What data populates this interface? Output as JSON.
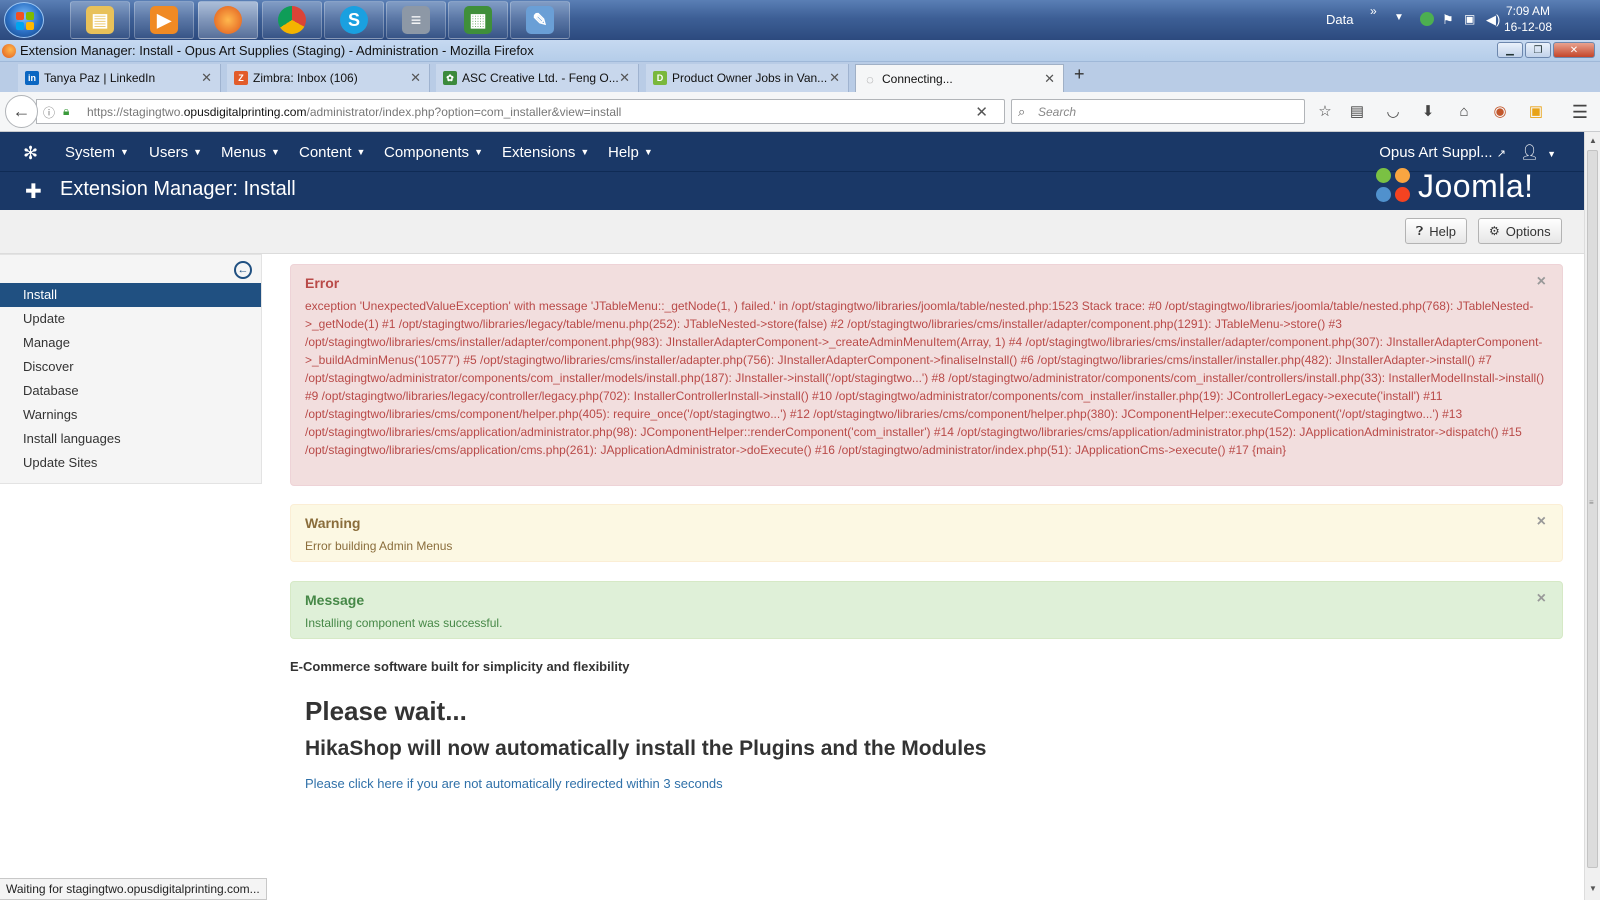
{
  "taskbar": {
    "apps": [
      {
        "name": "file-explorer",
        "color": "#e8c15a"
      },
      {
        "name": "media-player",
        "color": "#f08a24"
      },
      {
        "name": "firefox",
        "color": "#e8591c"
      },
      {
        "name": "chrome",
        "color": "#3e8e3e"
      },
      {
        "name": "skype",
        "color": "#1aa0e0",
        "glyph": "S"
      },
      {
        "name": "notepad",
        "color": "#8d98a6"
      },
      {
        "name": "excel",
        "color": "#3f8f3a"
      },
      {
        "name": "paint",
        "color": "#6a9fd6"
      }
    ],
    "tray": {
      "lang": "Data",
      "arrows": "»",
      "time": "7:09 AM",
      "date": "16-12-08"
    }
  },
  "window": {
    "title": "Extension Manager: Install - Opus Art Supplies (Staging) - Administration - Mozilla Firefox",
    "min": "▁",
    "max": "❐",
    "close": "✕"
  },
  "tabs": [
    {
      "label": "Tanya Paz | LinkedIn",
      "favicon": "in",
      "color": "#0a66c2"
    },
    {
      "label": "Zimbra: Inbox (106)",
      "favicon": "Z",
      "color": "#e25c2a"
    },
    {
      "label": "ASC Creative Ltd. - Feng O...",
      "favicon": "✿",
      "color": "#3b8a3b"
    },
    {
      "label": "Product Owner Jobs in Van...",
      "favicon": "D",
      "color": "#7ab83b"
    },
    {
      "label": "Connecting...",
      "favicon": "◌",
      "color": "#888888"
    }
  ],
  "newtab": "+",
  "nav": {
    "url_prefix": "https://stagingtwo.",
    "url_domain": "opusdigitalprinting.com",
    "url_path": "/administrator/index.php?option=com_installer&view=install",
    "search_placeholder": "Search"
  },
  "joomla": {
    "menu": [
      "System",
      "Users",
      "Menus",
      "Content",
      "Components",
      "Extensions",
      "Help"
    ],
    "site": "Opus Art Suppl...",
    "page_title": "Extension Manager: Install",
    "brand": "Joomla!",
    "toolbar": {
      "help": "Help",
      "options": "Options"
    },
    "sidebar": [
      "Install",
      "Update",
      "Manage",
      "Discover",
      "Database",
      "Warnings",
      "Install languages",
      "Update Sites"
    ],
    "alerts": {
      "error": {
        "heading": "Error",
        "body": "exception 'UnexpectedValueException' with message 'JTableMenu::_getNode(1, ) failed.' in /opt/stagingtwo/libraries/joomla/table/nested.php:1523 Stack trace: #0 /opt/stagingtwo/libraries/joomla/table/nested.php(768): JTableNested->_getNode(1) #1 /opt/stagingtwo/libraries/legacy/table/menu.php(252): JTableNested->store(false) #2 /opt/stagingtwo/libraries/cms/installer/adapter/component.php(1291): JTableMenu->store() #3 /opt/stagingtwo/libraries/cms/installer/adapter/component.php(983): JInstallerAdapterComponent->_createAdminMenuItem(Array, 1) #4 /opt/stagingtwo/libraries/cms/installer/adapter/component.php(307): JInstallerAdapterComponent->_buildAdminMenus('10577') #5 /opt/stagingtwo/libraries/cms/installer/adapter.php(756): JInstallerAdapterComponent->finaliseInstall() #6 /opt/stagingtwo/libraries/cms/installer/installer.php(482): JInstallerAdapter->install() #7 /opt/stagingtwo/administrator/components/com_installer/models/install.php(187): JInstaller->install('/opt/stagingtwo...') #8 /opt/stagingtwo/administrator/components/com_installer/controllers/install.php(33): InstallerModelInstall->install() #9 /opt/stagingtwo/libraries/legacy/controller/legacy.php(702): InstallerControllerInstall->install() #10 /opt/stagingtwo/administrator/components/com_installer/installer.php(19): JControllerLegacy->execute('install') #11 /opt/stagingtwo/libraries/cms/component/helper.php(405): require_once('/opt/stagingtwo...') #12 /opt/stagingtwo/libraries/cms/component/helper.php(380): JComponentHelper::executeComponent('/opt/stagingtwo...') #13 /opt/stagingtwo/libraries/cms/application/administrator.php(98): JComponentHelper::renderComponent('com_installer') #14 /opt/stagingtwo/libraries/cms/application/administrator.php(152): JApplicationAdministrator->dispatch() #15 /opt/stagingtwo/libraries/cms/application/cms.php(261): JApplicationAdministrator->doExecute() #16 /opt/stagingtwo/administrator/index.php(51): JApplicationCms->execute() #17 {main}"
      },
      "warning": {
        "heading": "Warning",
        "body": "Error building Admin Menus"
      },
      "message": {
        "heading": "Message",
        "body": "Installing component was successful."
      },
      "close": "×"
    },
    "content": {
      "tagline": "E-Commerce software built for simplicity and flexibility",
      "wait": "Please wait...",
      "hika": "HikaShop will now automatically install the Plugins and the Modules",
      "redirect": "Please click here if you are not automatically redirected within 3 seconds"
    }
  },
  "statusbar": "Waiting for stagingtwo.opusdigitalprinting.com..."
}
